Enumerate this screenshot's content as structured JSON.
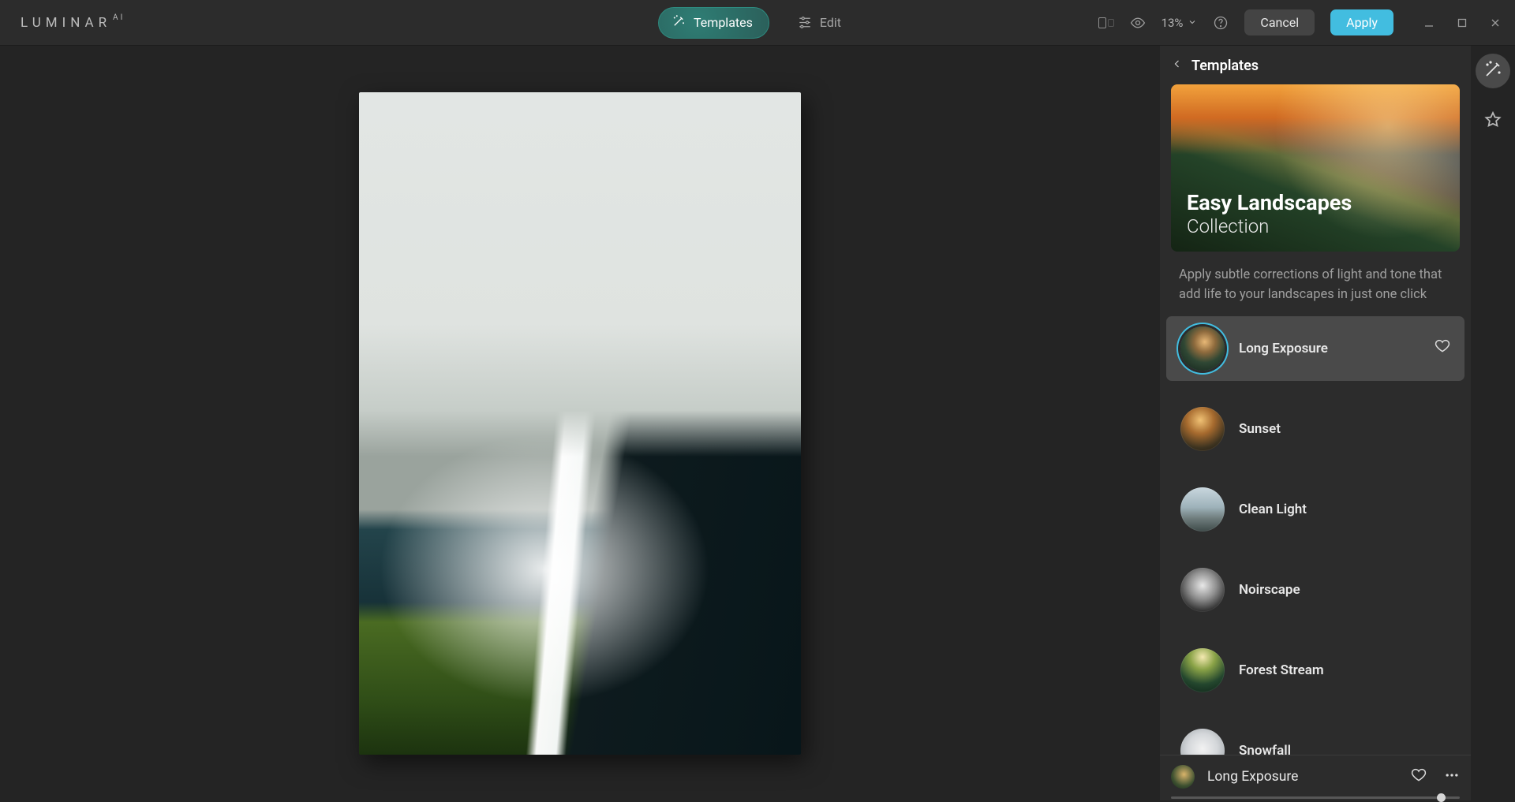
{
  "app": {
    "brand": "LUMINAR",
    "brand_suffix": "AI"
  },
  "toolbar": {
    "templates_label": "Templates",
    "edit_label": "Edit",
    "zoom": "13%",
    "cancel_label": "Cancel",
    "apply_label": "Apply"
  },
  "panel": {
    "header": "Templates",
    "collection": {
      "title": "Easy Landscapes",
      "subtitle": "Collection",
      "description": "Apply subtle corrections of light and tone that add life to your landscapes in just one click"
    },
    "templates": [
      {
        "name": "Long Exposure",
        "selected": true,
        "thumb_class": "longexp"
      },
      {
        "name": "Sunset",
        "selected": false,
        "thumb_class": "sunset"
      },
      {
        "name": "Clean Light",
        "selected": false,
        "thumb_class": "clean"
      },
      {
        "name": "Noirscape",
        "selected": false,
        "thumb_class": "noir"
      },
      {
        "name": "Forest Stream",
        "selected": false,
        "thumb_class": "forest"
      },
      {
        "name": "Snowfall",
        "selected": false,
        "thumb_class": "snow"
      }
    ],
    "applied": {
      "name": "Long Exposure"
    }
  },
  "colors": {
    "accent": "#42bde0"
  }
}
